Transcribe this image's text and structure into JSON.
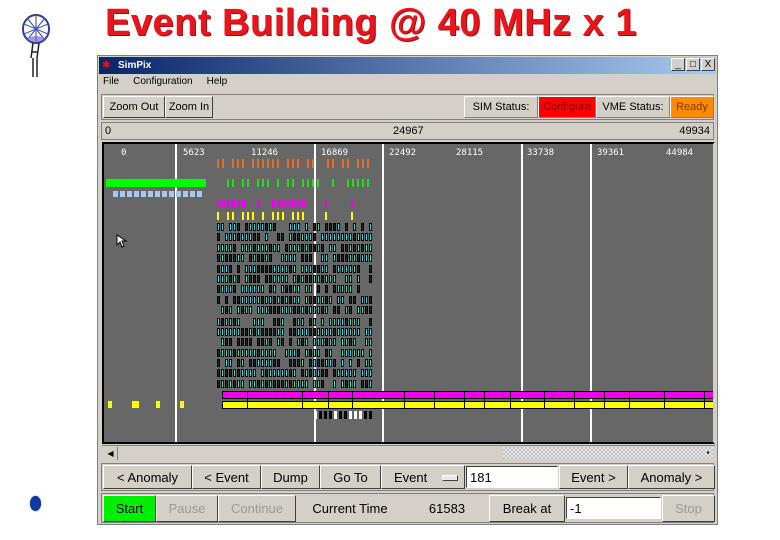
{
  "slide": {
    "title": "Event Building @ 40 MHz x 1",
    "logo_icon": "detector-logo-icon",
    "bullet_icon": "blue-bullet-icon"
  },
  "window": {
    "title": "SimPix",
    "app_icon": "simpix-app-icon",
    "controls": {
      "minimize": "_",
      "maximize": "□",
      "close": "X"
    }
  },
  "menu": [
    "File",
    "Configuration",
    "Help"
  ],
  "toolbar": {
    "zoom_out": "Zoom Out",
    "zoom_in": "Zoom In",
    "sim_status_label": "SIM Status:",
    "sim_status_value": "Configure",
    "vme_status_label": "VME Status:",
    "vme_status_value": "Ready",
    "colors": {
      "configure": "#ff0000",
      "ready": "#ff8c00"
    }
  },
  "range": {
    "start": "0",
    "mid": "24967",
    "end": "49934"
  },
  "timeline": {
    "ticks": [
      "0",
      "5623",
      "11246",
      "16869",
      "22492",
      "28115",
      "33738",
      "39361",
      "44984"
    ],
    "range": [
      0,
      49934
    ],
    "colors": {
      "background": "#676767",
      "orange": "#e0702a",
      "green": "#22dd22",
      "bright_green": "#00ff00",
      "light_blue": "#a8c8f0",
      "magenta": "#ee00ee",
      "yellow": "#ffff00",
      "cyan": "#33e0e0"
    }
  },
  "nav": {
    "prev_anomaly": "< Anomaly",
    "prev_event": "< Event",
    "dump": "Dump",
    "goto": "Go To",
    "goto_type": "Event",
    "goto_value": "181",
    "next_event": "Event >",
    "next_anomaly": "Anomaly >"
  },
  "controls": {
    "start": "Start",
    "pause": "Pause",
    "continue": "Continue",
    "current_time_label": "Current Time",
    "current_time_value": "61583",
    "break_at": "Break at",
    "break_value": "-1",
    "stop": "Stop"
  }
}
